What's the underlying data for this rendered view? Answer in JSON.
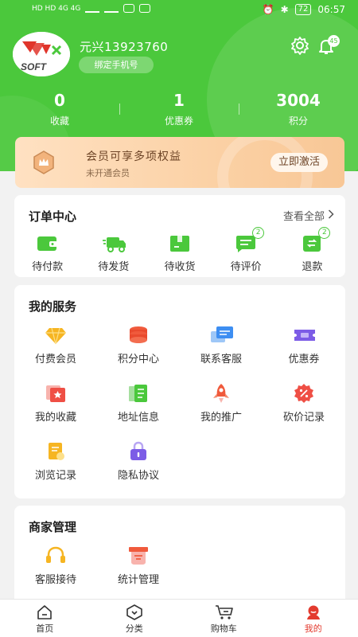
{
  "status_bar": {
    "time": "06:57",
    "battery": "72",
    "left_text": "HD HD 4G 4G"
  },
  "profile": {
    "username": "元兴13923760",
    "bind_phone_label": "绑定手机号",
    "notification_count": "45"
  },
  "stats": [
    {
      "value": "0",
      "label": "收藏"
    },
    {
      "value": "1",
      "label": "优惠券"
    },
    {
      "value": "3004",
      "label": "积分"
    }
  ],
  "membership": {
    "title": "会员可享多项权益",
    "subtitle": "未开通会员",
    "action_label": "立即激活"
  },
  "orders": {
    "title": "订单中心",
    "view_all": "查看全部",
    "items": [
      {
        "label": "待付款",
        "icon": "wallet-icon",
        "badge": ""
      },
      {
        "label": "待发货",
        "icon": "truck-icon",
        "badge": ""
      },
      {
        "label": "待收货",
        "icon": "package-icon",
        "badge": ""
      },
      {
        "label": "待评价",
        "icon": "comment-icon",
        "badge": "2"
      },
      {
        "label": "退款",
        "icon": "refund-icon",
        "badge": "2"
      }
    ]
  },
  "services": {
    "title": "我的服务",
    "items": [
      {
        "label": "付费会员",
        "icon": "diamond-icon"
      },
      {
        "label": "积分中心",
        "icon": "coins-icon"
      },
      {
        "label": "联系客服",
        "icon": "chat-icon"
      },
      {
        "label": "优惠券",
        "icon": "coupon-icon"
      },
      {
        "label": "我的收藏",
        "icon": "favorite-icon"
      },
      {
        "label": "地址信息",
        "icon": "address-icon"
      },
      {
        "label": "我的推广",
        "icon": "rocket-icon"
      },
      {
        "label": "砍价记录",
        "icon": "discount-icon"
      },
      {
        "label": "浏览记录",
        "icon": "history-icon"
      },
      {
        "label": "隐私协议",
        "icon": "lock-icon"
      }
    ]
  },
  "merchant": {
    "title": "商家管理",
    "items": [
      {
        "label": "客服接待",
        "icon": "headset-icon"
      },
      {
        "label": "统计管理",
        "icon": "statistics-icon"
      }
    ]
  },
  "nav": [
    {
      "label": "首页",
      "icon": "home-icon"
    },
    {
      "label": "分类",
      "icon": "category-icon"
    },
    {
      "label": "购物车",
      "icon": "cart-icon"
    },
    {
      "label": "我的",
      "icon": "profile-icon"
    }
  ],
  "colors": {
    "brand": "#4bc83c",
    "member_text": "#6d4426",
    "active_nav": "#e33b2f"
  }
}
